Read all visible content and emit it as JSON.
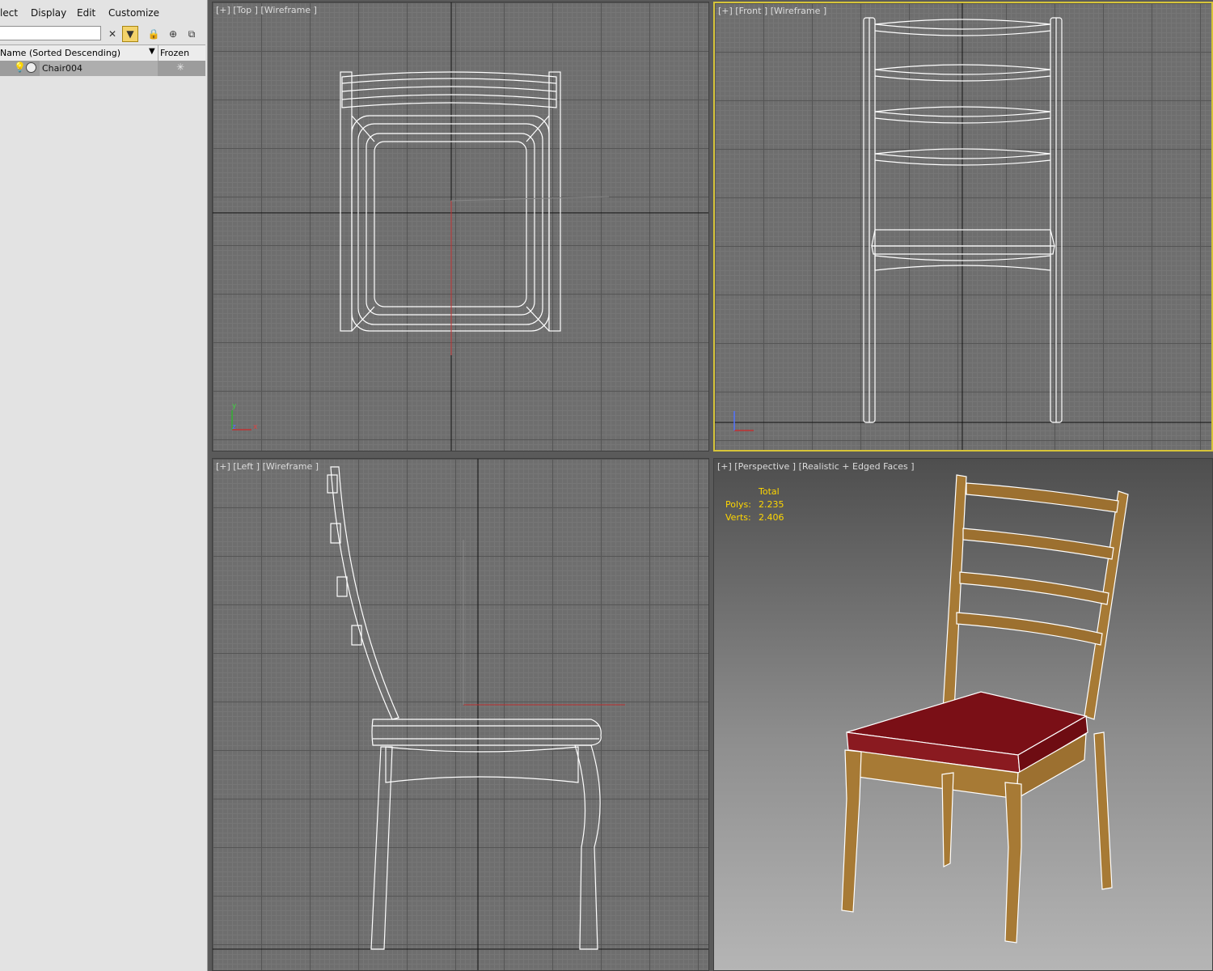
{
  "menu": {
    "items": [
      "lect",
      "Display",
      "Edit",
      "Customize"
    ]
  },
  "toolbar": {
    "search_value": ""
  },
  "scene_explorer": {
    "columns": {
      "name": "Name (Sorted Descending)",
      "frozen": "Frozen"
    },
    "rows": [
      {
        "name": "Chair004"
      }
    ]
  },
  "viewports": {
    "top": {
      "label": "[+] [Top ] [Wireframe ]"
    },
    "front": {
      "label": "[+] [Front ] [Wireframe ]"
    },
    "left": {
      "label": "[+] [Left ] [Wireframe ]"
    },
    "perspective": {
      "label": "[+] [Perspective ] [Realistic + Edged Faces ]"
    }
  },
  "stats": {
    "header": "Total",
    "polys_label": "Polys:",
    "polys_value": "2.235",
    "verts_label": "Verts:",
    "verts_value": "2.406"
  },
  "axis_letters": {
    "x": "x",
    "y": "y",
    "z": "z"
  },
  "colors": {
    "active_border": "#d6c43a",
    "seat": "#7a0f16",
    "wood": "#a77a35",
    "wire": "#ffffff"
  }
}
